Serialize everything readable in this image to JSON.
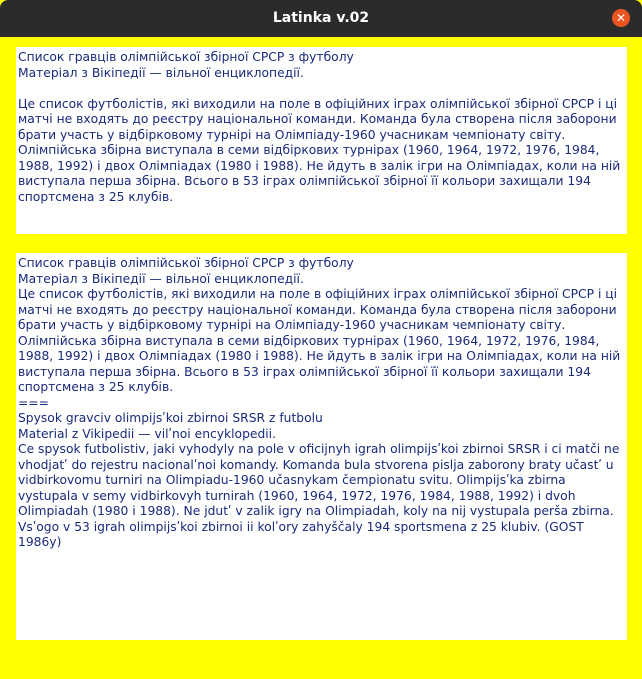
{
  "window": {
    "title": "Latinka v.02",
    "close_symbol": "✕"
  },
  "input_text": "Список гравців олімпійської збірної СРСР з футболу\nМатеріал з Вікіпедії — вільної енциклопедії.\n\nЦе список футболістів, які виходили на поле в офіційних іграх олімпійської збірної СРСР і ці матчі не входять до реєстру національної команди. Команда була створена після заборони брати участь у відбірковому турнірі на Олімпіаду-1960 учасникам чемпіонату світу. Олімпійська збірна виступала в семи відбіркових турнірах (1960, 1964, 1972, 1976, 1984, 1988, 1992) і двох Олімпіадах (1980 і 1988). Не йдуть в залік ігри на Олімпіадах, коли на ній виступала перша збірна. Всього в 53 іграх олімпійської збірної її кольори захищали 194 спортсмена з 25 клубів.",
  "output_text": "Список гравців олімпійської збірної СРСР з футболу\nМатеріал з Вікіпедії — вільної енциклопедії.\nЦе список футболістів, які виходили на поле в офіційних іграх олімпійської збірної СРСР і ці матчі не входять до реєстру національної команди. Команда була створена після заборони брати участь у відбірковому турнірі на Олімпіаду-1960 учасникам чемпіонату світу. Олімпійська збірна виступала в семи відбіркових турнірах (1960, 1964, 1972, 1976, 1984, 1988, 1992) і двох Олімпіадах (1980 і 1988). Не йдуть в залік ігри на Олімпіадах, коли на ній виступала перша збірна. Всього в 53 іграх олімпійської збірної її кольори захищали 194 спортсмена з 25 клубів.\n===\nSpysok gravciv olimpijsʹkoi zbirnoi SRSR z futbolu\nMaterial z Vikipedii — vilʹnoi encyklopedii.\nCe spysok futbolistiv, jaki vyhodyly na pole v oficijnyh igrah olimpijsʹkoi zbirnoi SRSR i ci matči ne vhodjatʹ do rejestru nacionalʹnoi komandy. Komanda bula stvorena pislja zaborony braty učastʹ u vidbirkovomu turniri na Olimpiadu-1960 učasnykam čempionatu svitu. Olimpijsʹka zbirna vystupala v semy vidbirkovyh turnirah (1960, 1964, 1972, 1976, 1984, 1988, 1992) i dvoh Olimpiadah (1980 i 1988). Ne jdutʹ v zalik igry na Olimpiadah, koly na nij vystupala perša zbirna. Vsʹogo v 53 igrah olimpijsʹkoi zbirnoi ii kolʹory zahyščaly 194 sportsmena z 25 klubiv. (GOST 1986y)"
}
